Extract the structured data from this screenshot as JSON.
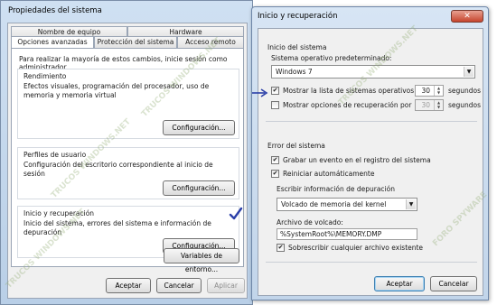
{
  "colors": {
    "accent": "#2b3fa8",
    "close": "#c6452e",
    "title_bar": "#cfe0f2"
  },
  "system_properties": {
    "title": "Propiedades del sistema",
    "tabs_top": [
      "Nombre de equipo",
      "Hardware"
    ],
    "tabs_bottom": [
      "Opciones avanzadas",
      "Protección del sistema",
      "Acceso remoto"
    ],
    "active_tab": "Opciones avanzadas",
    "admin_note": "Para realizar la mayoría de estos cambios, inicie sesión como administrador.",
    "performance": {
      "title": "Rendimiento",
      "desc": "Efectos visuales, programación del procesador, uso de memoria y memoria virtual",
      "button": "Configuración..."
    },
    "profiles": {
      "title": "Perfiles de usuario",
      "desc": "Configuración del escritorio correspondiente al inicio de sesión",
      "button": "Configuración..."
    },
    "startup": {
      "title": "Inicio y recuperación",
      "desc": "Inicio del sistema, errores del sistema e información de depuración",
      "button": "Configuración..."
    },
    "env_button": "Variables de entorno...",
    "ok": "Aceptar",
    "cancel": "Cancelar",
    "apply": "Aplicar",
    "watermarks": [
      "TRUCOS WINDOWS.NET",
      "TRUCOS WINDOWS.NET",
      "TRUCOS WINDOWS.NET"
    ]
  },
  "startup_recovery": {
    "title": "Inicio y recuperación",
    "close_glyph": "✕",
    "system_start": {
      "section": "Inicio del sistema",
      "default_os_label": "Sistema operativo predeterminado:",
      "default_os_value": "Windows 7",
      "show_list_label": "Mostrar la lista de sistemas operativos por",
      "show_list_checked": true,
      "show_list_seconds": "30",
      "show_recovery_label": "Mostrar opciones de recuperación por",
      "show_recovery_checked": false,
      "show_recovery_seconds": "30",
      "seconds_unit": "segundos"
    },
    "system_failure": {
      "section": "Error del sistema",
      "write_event_label": "Grabar un evento en el registro del sistema",
      "write_event_checked": true,
      "auto_restart_label": "Reiniciar automáticamente",
      "auto_restart_checked": true,
      "debug_info_label": "Escribir información de depuración",
      "debug_info_value": "Volcado de memoria del kernel",
      "dump_file_label": "Archivo de volcado:",
      "dump_file_value": "%SystemRoot%\\MEMORY.DMP",
      "overwrite_label": "Sobrescribir cualquier archivo existente",
      "overwrite_checked": true
    },
    "ok": "Aceptar",
    "cancel": "Cancelar",
    "watermarks": [
      "TRUCOS WINDOWS.NET",
      "FORO SPYWARE"
    ]
  }
}
